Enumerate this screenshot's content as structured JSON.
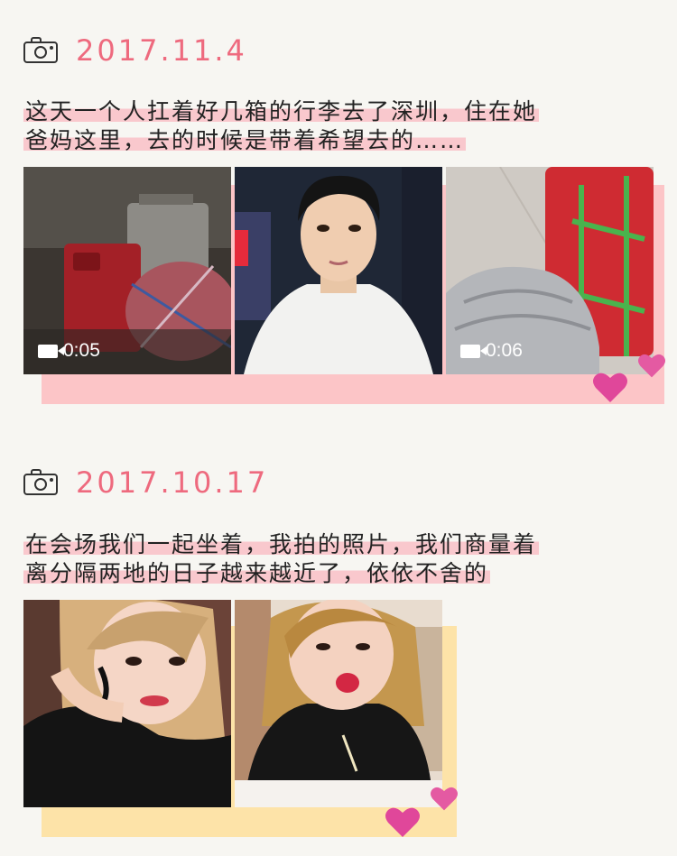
{
  "entries": [
    {
      "date": "2017.11.4",
      "text_line1": "这天一个人扛着好几箱的行李去了深圳，住在她",
      "text_line2": "爸妈这里，去的时候是带着希望去的……",
      "photos": [
        {
          "kind": "video",
          "duration": "0:05",
          "subject": "suitcases"
        },
        {
          "kind": "photo",
          "subject": "selfie"
        },
        {
          "kind": "video",
          "duration": "0:06",
          "subject": "luggage"
        }
      ],
      "backdrop_color": "#fcc5c7"
    },
    {
      "date": "2017.10.17",
      "text_line1": "在会场我们一起坐着，我拍的照片，我们商量着",
      "text_line2": "离分隔两地的日子越来越近了，依依不舍的",
      "photos": [
        {
          "kind": "photo",
          "subject": "portrait"
        },
        {
          "kind": "photo",
          "subject": "kiss-face"
        }
      ],
      "backdrop_color": "#fde3a8"
    }
  ],
  "colors": {
    "date": "#ee6a7e",
    "heart": "#e0479a"
  }
}
